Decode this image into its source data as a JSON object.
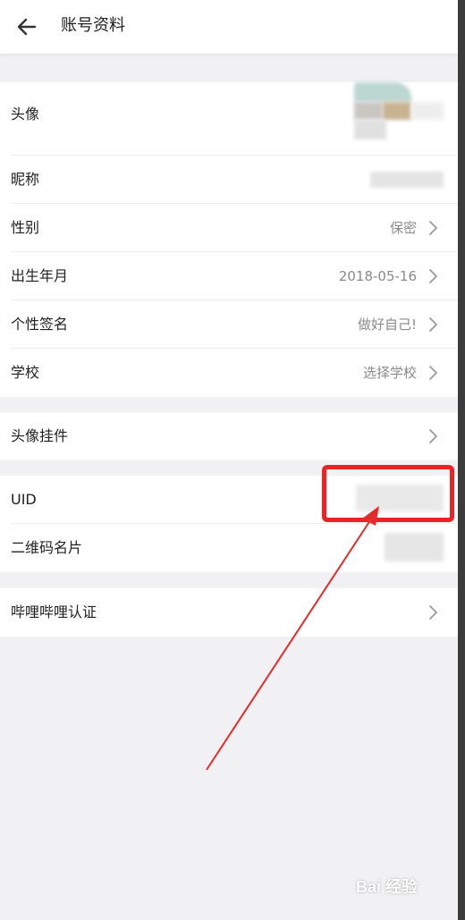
{
  "header": {
    "title": "账号资料"
  },
  "group1": {
    "avatar_label": "头像",
    "nickname_label": "昵称",
    "gender_label": "性别",
    "gender_value": "保密",
    "birth_label": "出生年月",
    "birth_value": "2018-05-16",
    "signature_label": "个性签名",
    "signature_value": "做好自己!",
    "school_label": "学校",
    "school_value": "选择学校"
  },
  "group2": {
    "pendant_label": "头像挂件"
  },
  "group3": {
    "uid_label": "UID",
    "qrcode_label": "二维码名片"
  },
  "group4": {
    "verify_label": "哔哩哔哩认证"
  },
  "watermark": "Bai 经验",
  "colors": {
    "annotation": "#ee2222",
    "background": "#f1f1f3"
  }
}
